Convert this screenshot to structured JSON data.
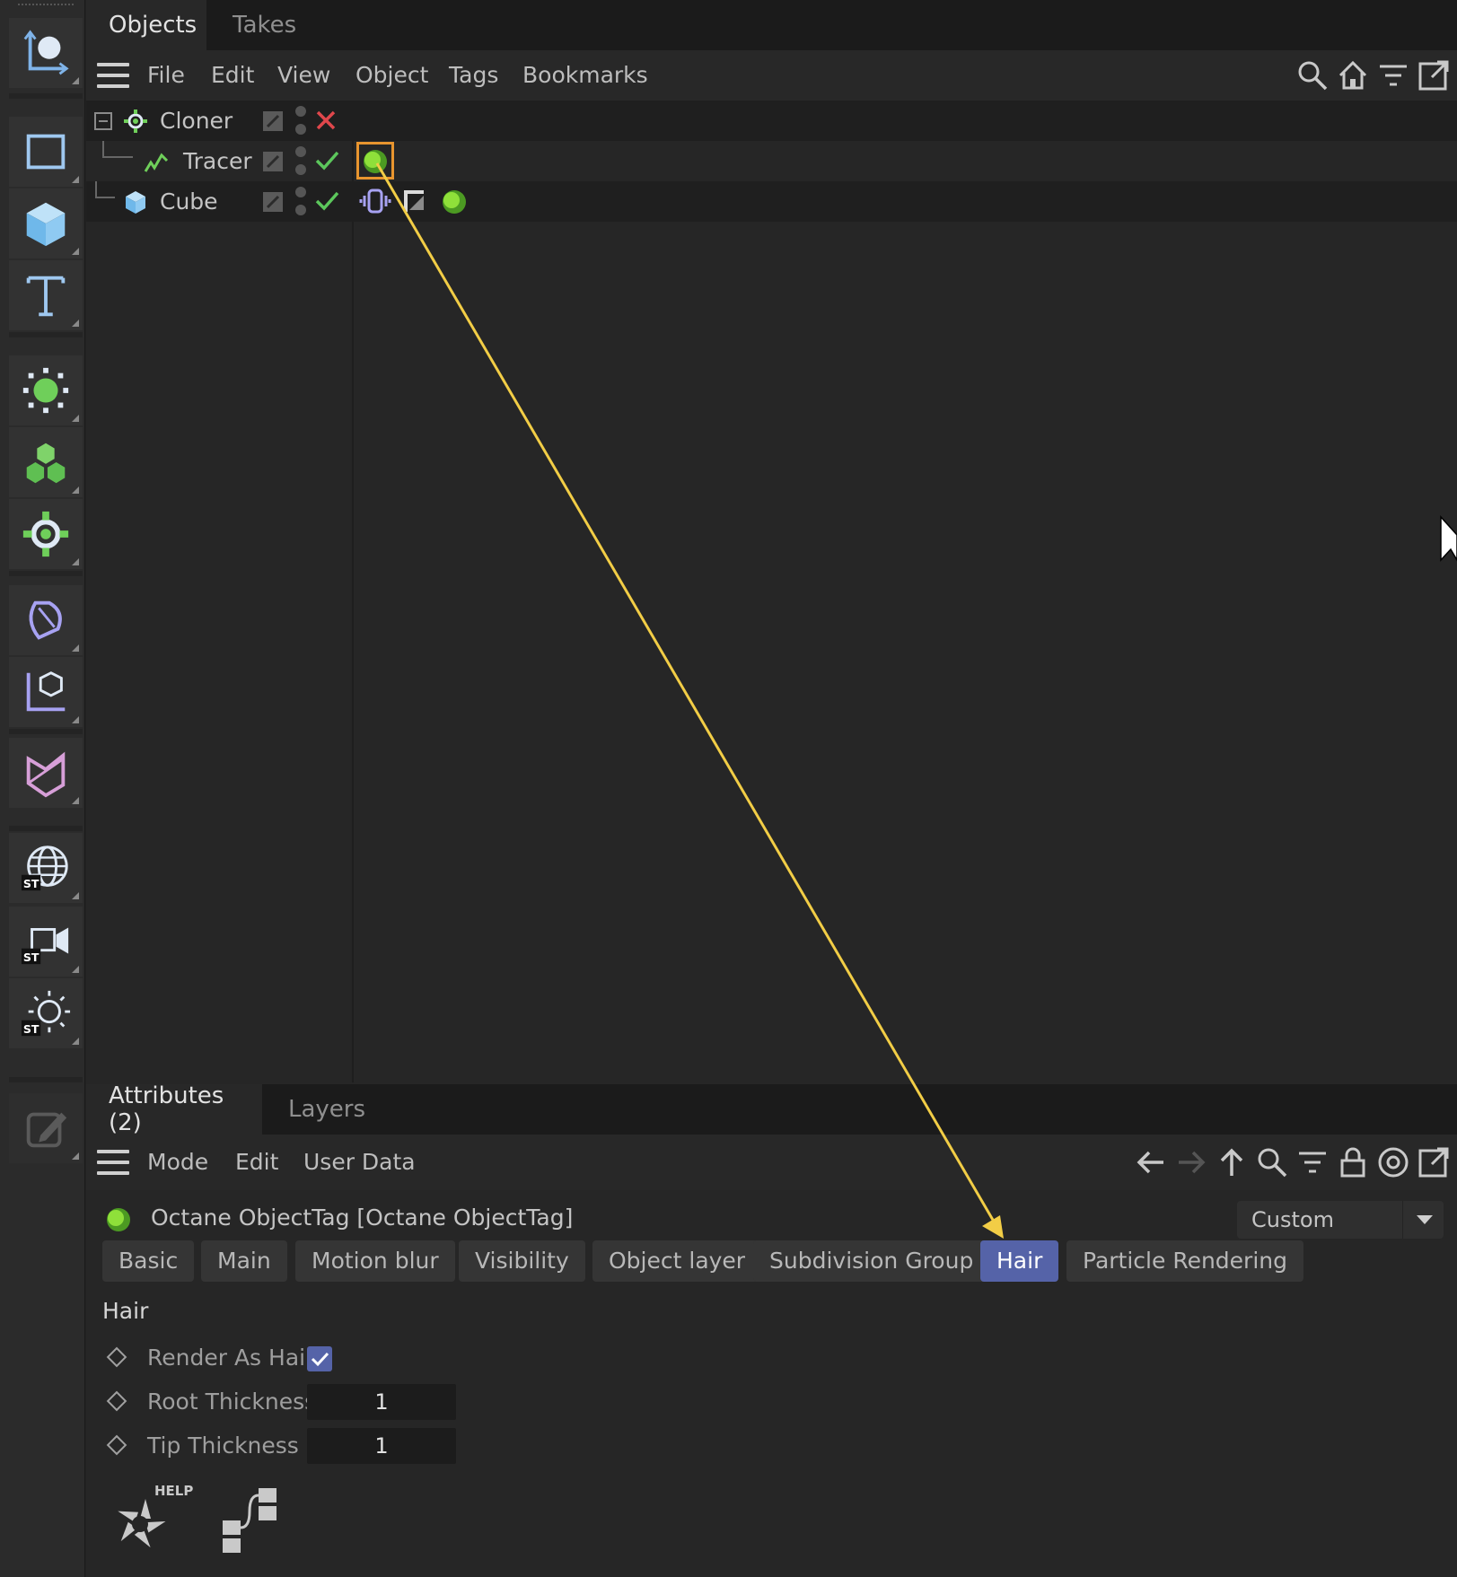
{
  "objects_panel": {
    "tabs": [
      "Objects",
      "Takes"
    ],
    "menu": [
      "File",
      "Edit",
      "View",
      "Object",
      "Tags",
      "Bookmarks"
    ],
    "header_icons": [
      "search-icon",
      "home-icon",
      "filter-icon",
      "new-window-icon"
    ],
    "tree": [
      {
        "name": "Cloner",
        "icon": "cloner-icon",
        "enabled": false,
        "tags": []
      },
      {
        "name": "Tracer",
        "icon": "tracer-icon",
        "enabled": true,
        "tags": [
          "octane-object-tag"
        ]
      },
      {
        "name": "Cube",
        "icon": "cube-icon",
        "enabled": true,
        "tags": [
          "vibrate-tag",
          "phong-tag",
          "octane-object-tag"
        ]
      }
    ]
  },
  "attributes_panel": {
    "tabs": [
      "Attributes (2)",
      "Layers"
    ],
    "menu": [
      "Mode",
      "Edit",
      "User Data"
    ],
    "header_icons": [
      "back-arrow-icon",
      "forward-arrow-icon",
      "up-arrow-icon",
      "search-icon",
      "filter-icon",
      "lock-icon",
      "target-icon",
      "new-window-icon"
    ],
    "title": "Octane ObjectTag [Octane ObjectTag]",
    "mode_select": "Custom",
    "subtabs": [
      "Basic",
      "Main",
      "Motion blur",
      "Visibility",
      "Object layer",
      "Subdivision Group",
      "Hair",
      "Particle Rendering"
    ],
    "active_subtab": "Hair",
    "group_title": "Hair",
    "params": {
      "render_as_hair": {
        "label": "Render As Hair",
        "checked": true
      },
      "root_thickness": {
        "label": "Root Thickness",
        "value": "1"
      },
      "tip_thickness": {
        "label": "Tip Thickness",
        "value": "1"
      }
    },
    "help_label": "HELP"
  },
  "colors": {
    "accent": "#5563a8",
    "octane_green": "#6fcf2a",
    "annotation": "#f2cd46",
    "highlight_box": "#e8952f",
    "check_green": "#5cc75c",
    "cross_red": "#e0474c"
  }
}
